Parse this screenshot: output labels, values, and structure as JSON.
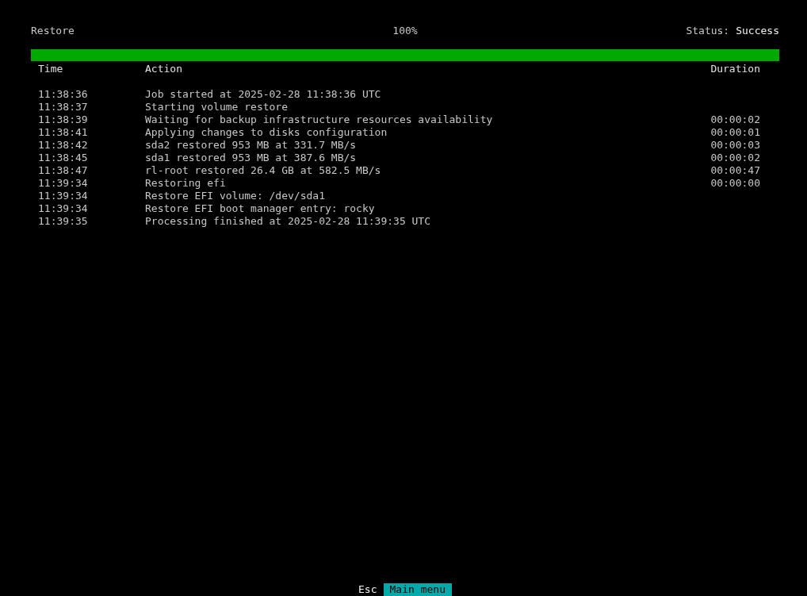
{
  "header": {
    "title": "Restore",
    "percent": "100%",
    "status_label": "Status:",
    "status_value": "Success"
  },
  "progress": {
    "level": 1
  },
  "table": {
    "columns": [
      "Time",
      "Action",
      "Duration"
    ],
    "rows": [
      {
        "time": "11:38:36",
        "action": "Job started at 2025-02-28 11:38:36 UTC",
        "duration": ""
      },
      {
        "time": "11:38:37",
        "action": "Starting volume restore",
        "duration": ""
      },
      {
        "time": "11:38:39",
        "action": "Waiting for backup infrastructure resources availability",
        "duration": "00:00:02"
      },
      {
        "time": "11:38:41",
        "action": "Applying changes to disks configuration",
        "duration": "00:00:01"
      },
      {
        "time": "11:38:42",
        "action": "sda2 restored 953 MB at 331.7 MB/s",
        "duration": "00:00:03"
      },
      {
        "time": "11:38:45",
        "action": "sda1 restored 953 MB at 387.6 MB/s",
        "duration": "00:00:02"
      },
      {
        "time": "11:38:47",
        "action": "rl-root restored 26.4 GB at 582.5 MB/s",
        "duration": "00:00:47"
      },
      {
        "time": "11:39:34",
        "action": "Restoring efi",
        "duration": "00:00:00"
      },
      {
        "time": "11:39:34",
        "action": "Restore EFI volume: /dev/sda1",
        "duration": ""
      },
      {
        "time": "11:39:34",
        "action": "Restore EFI boot manager entry: rocky",
        "duration": ""
      },
      {
        "time": "11:39:35",
        "action": "Processing finished at 2025-02-28 11:39:35 UTC",
        "duration": ""
      }
    ]
  },
  "footer": {
    "key": "Esc",
    "action": "Main menu"
  }
}
